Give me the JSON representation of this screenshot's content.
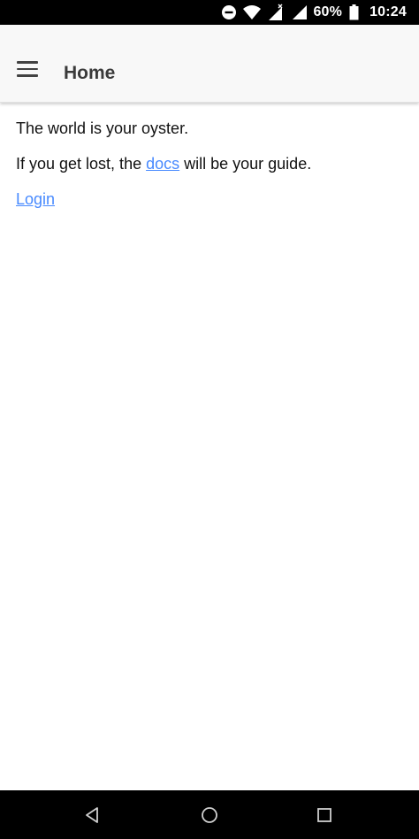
{
  "status_bar": {
    "battery_percent": "60%",
    "time": "10:24",
    "icons": [
      "do-not-disturb-icon",
      "wifi-icon",
      "signal-icon",
      "battery-icon"
    ]
  },
  "header": {
    "menu_icon": "hamburger-menu-icon",
    "title": "Home"
  },
  "content": {
    "line1": "The world is your oyster.",
    "line2_before": "If you get lost, the ",
    "line2_link": "docs",
    "line2_after": " will be your guide.",
    "login_link": "Login"
  },
  "colors": {
    "link": "#488aff",
    "app_bar_bg": "#f8f8f8",
    "title": "#3a3a3a",
    "status_bar_bg": "#000000"
  },
  "nav_bar": {
    "icons": [
      "back-icon",
      "home-icon",
      "recents-icon"
    ]
  }
}
